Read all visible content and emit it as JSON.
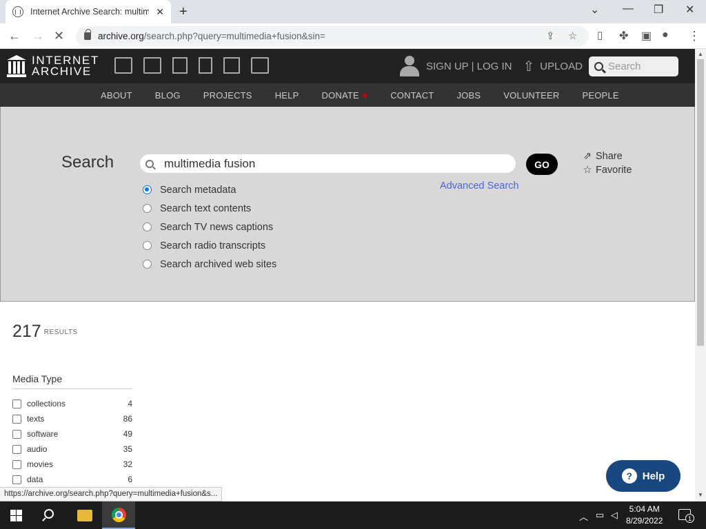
{
  "browser": {
    "tab_title": "Internet Archive Search: multime",
    "url_host": "archive.org",
    "url_path": "/search.php?query=multimedia+fusion&sin=",
    "status_url": "https://archive.org/search.php?query=multimedia+fusion&s..."
  },
  "header": {
    "logo_line1": "INTERNET",
    "logo_line2": "ARCHIVE",
    "auth_label": "SIGN UP | LOG IN",
    "upload_label": "UPLOAD",
    "search_placeholder": "Search"
  },
  "subnav": [
    "ABOUT",
    "BLOG",
    "PROJECTS",
    "HELP",
    "DONATE",
    "CONTACT",
    "JOBS",
    "VOLUNTEER",
    "PEOPLE"
  ],
  "search": {
    "title": "Search",
    "query": "multimedia fusion",
    "go_label": "GO",
    "advanced_label": "Advanced Search",
    "share_label": "Share",
    "favorite_label": "Favorite",
    "options": [
      {
        "label": "Search metadata",
        "checked": true
      },
      {
        "label": "Search text contents",
        "checked": false
      },
      {
        "label": "Search TV news captions",
        "checked": false
      },
      {
        "label": "Search radio transcripts",
        "checked": false
      },
      {
        "label": "Search archived web sites",
        "checked": false
      }
    ]
  },
  "results": {
    "count": "217",
    "label": "RESULTS"
  },
  "facets": {
    "title": "Media Type",
    "items": [
      {
        "label": "collections",
        "count": "4"
      },
      {
        "label": "texts",
        "count": "86"
      },
      {
        "label": "software",
        "count": "49"
      },
      {
        "label": "audio",
        "count": "35"
      },
      {
        "label": "movies",
        "count": "32"
      },
      {
        "label": "data",
        "count": "6"
      }
    ]
  },
  "help_label": "Help",
  "taskbar": {
    "time": "5:04 AM",
    "date": "8/29/2022",
    "notifications": "1"
  }
}
